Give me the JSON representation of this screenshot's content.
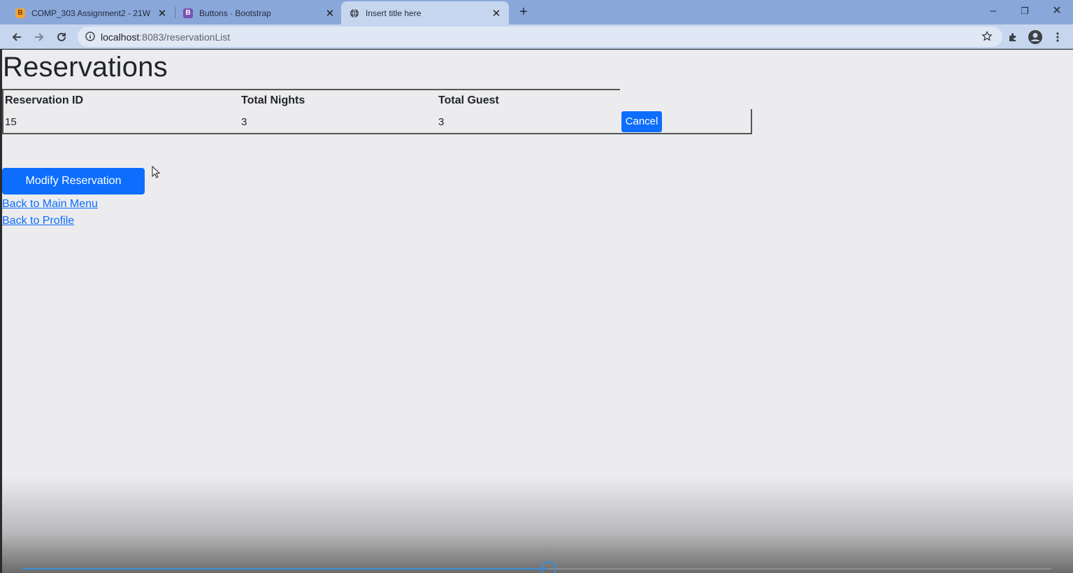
{
  "browser": {
    "tabs": [
      {
        "title": "COMP_303 Assignment2 - 21W",
        "favicon": "blackboard-icon",
        "active": false
      },
      {
        "title": "Buttons · Bootstrap",
        "favicon": "bootstrap-icon",
        "active": false
      },
      {
        "title": "Insert title here",
        "favicon": "globe-icon",
        "active": true
      }
    ],
    "url_host": "localhost",
    "url_path": ":8083/reservationList",
    "colors": {
      "tabstrip": "#8aa7d9",
      "toolbar": "#c6d6ef"
    }
  },
  "page": {
    "title": "Reservations",
    "table": {
      "headers": [
        "Reservation ID",
        "Total Nights",
        "Total Guest"
      ],
      "rows": [
        {
          "id": "15",
          "nights": "3",
          "guests": "3",
          "action_label": "Cancel"
        }
      ]
    },
    "modify_label": "Modify Reservation",
    "links": {
      "main_menu": "Back to Main Menu",
      "profile": "Back to Profile"
    },
    "colors": {
      "primary": "#0d6efd",
      "text": "#212529"
    }
  }
}
